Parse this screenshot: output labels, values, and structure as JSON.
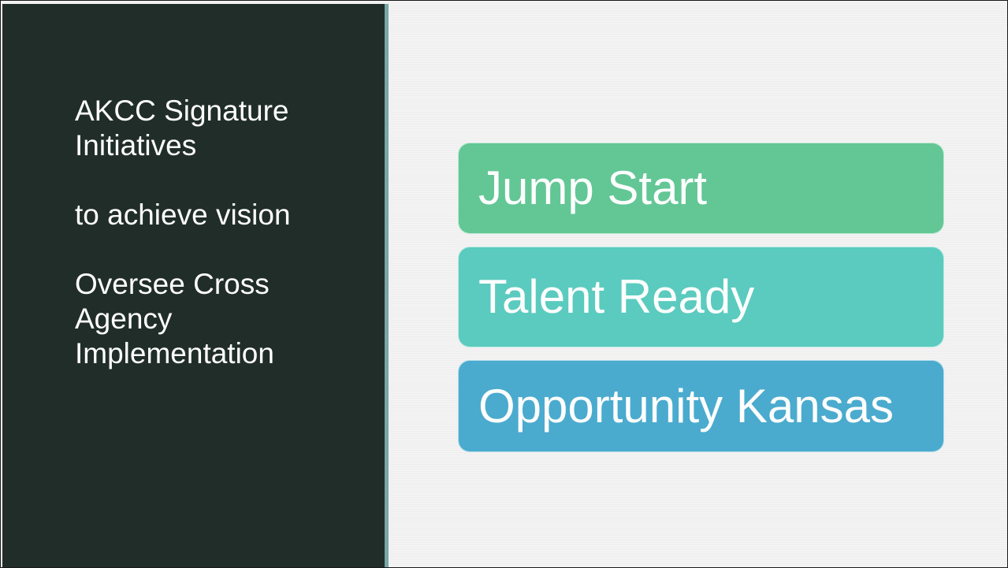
{
  "left_panel": {
    "title": "AKCC Signature Initiatives",
    "subtitle_1": "to achieve vision",
    "subtitle_2": "Oversee Cross Agency Implementation"
  },
  "initiatives": [
    {
      "label": "Jump Start",
      "color": "#62c794"
    },
    {
      "label": "Talent Ready",
      "color": "#5bcbbf"
    },
    {
      "label": "Opportunity Kansas",
      "color": "#4babce"
    }
  ],
  "colors": {
    "left_panel_bg": "#202d29",
    "accent_bar": "#7aa7a5",
    "right_panel_bg": "#f2f2f2"
  }
}
